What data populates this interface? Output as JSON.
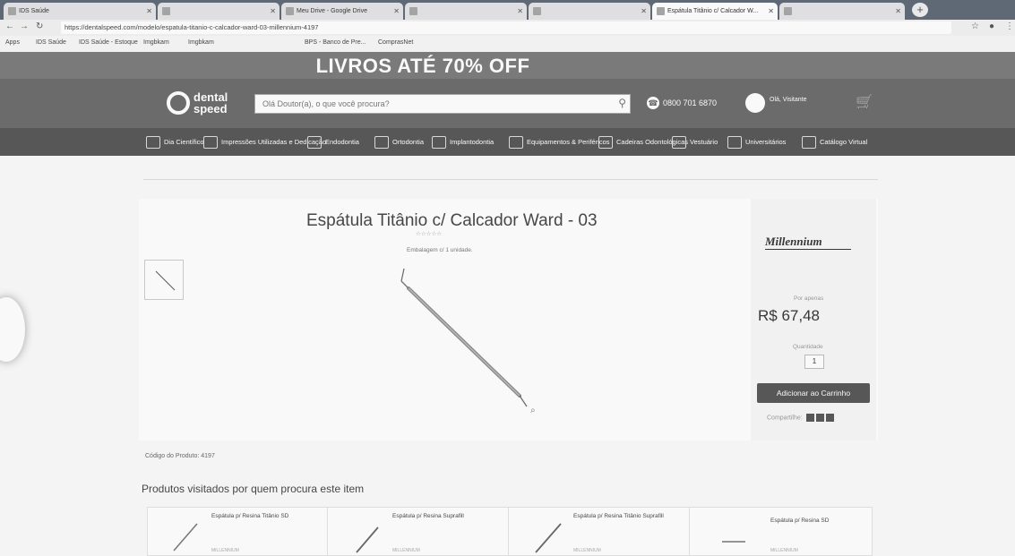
{
  "browser": {
    "tabs": [
      {
        "label": "IDS Saúde"
      },
      {
        "label": ""
      },
      {
        "label": "Meu Drive - Google Drive"
      },
      {
        "label": ""
      },
      {
        "label": ""
      },
      {
        "label": "Espátula Titânio c/ Calcador W..."
      },
      {
        "label": ""
      }
    ],
    "url": "https://dentalspeed.com/modelo/espatula-titanio-c-calcador-ward-03-millennium-4197",
    "bookmarks": [
      "Apps",
      "IDS Saúde",
      "IDS Saúde - Estoque",
      "Imgbkam",
      "Imgbkam",
      "",
      "BPS - Banco de Pre...",
      "ComprasNet",
      "",
      ""
    ]
  },
  "banner": {
    "text": "LIVROS ATÉ 70% OFF",
    "small": ""
  },
  "header": {
    "logo_top": "dental",
    "logo_bottom": "speed",
    "search_placeholder": "Olá Doutor(a), o que você procura?",
    "phone": "0800 701 6870",
    "account_line1": "Olá, Visitante",
    "account_line2": ""
  },
  "menu": {
    "items": [
      "Dia Científico",
      "Impressões Utilizadas e Dedicação",
      "Endodontia",
      "Ortodontia",
      "Implantodontia",
      "Equipamentos & Periféricos",
      "Cadeiras Odontológicas",
      "Vestuário",
      "Universitários",
      "Catálogo Virtual"
    ]
  },
  "breadcrumb": "",
  "product": {
    "title": "Espátula Titânio c/ Calcador Ward - 03",
    "rating_text": "",
    "packaging": "Embalagem c/ 1 unidade.",
    "brand": "Millennium",
    "price_prefix": "Por apenas",
    "price": "R$ 67,48",
    "quantity_label": "Quantidade",
    "quantity": "1",
    "add_to_cart": "Adicionar ao Carrinho",
    "share_label": "Compartilhe:",
    "code": "Código do Produto: 4197"
  },
  "related": {
    "title": "Produtos visitados por quem procura este item",
    "items": [
      {
        "name": "Espátula p/ Resina Titânio SD",
        "brand": "MILLENNIUM"
      },
      {
        "name": "Espátula p/ Resina Suprafill",
        "brand": "MILLENNIUM"
      },
      {
        "name": "Espátula p/ Resina Titânio Suprafill",
        "brand": "MILLENNIUM"
      },
      {
        "name": "Espátula p/ Resina SD",
        "brand": "MILLENNIUM"
      }
    ]
  },
  "colors": {
    "accent": "#555555",
    "header": "#6a6a6a"
  },
  "icons": [
    "search-icon",
    "phone-icon",
    "user-icon",
    "cart-icon",
    "zoom-icon",
    "facebook-icon",
    "twitter-icon",
    "share-icon"
  ]
}
